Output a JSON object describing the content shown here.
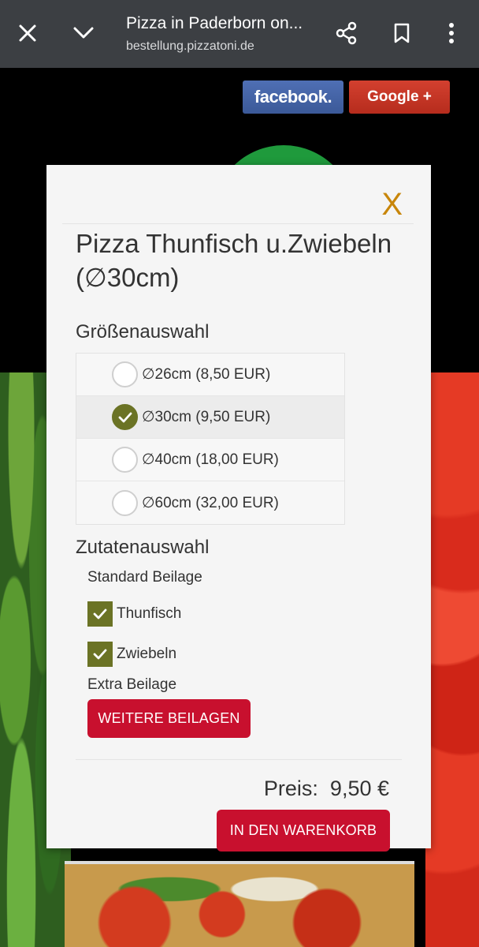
{
  "browser": {
    "title": "Pizza in Paderborn on...",
    "url": "bestellung.pizzatoni.de"
  },
  "social": {
    "facebook": "facebook.",
    "google": "Google +"
  },
  "modal": {
    "close": "X",
    "title": "Pizza Thunfisch u.Zwiebeln (∅30cm)",
    "size_heading": "Größenauswahl",
    "sizes": [
      {
        "label": "∅26cm (8,50 EUR)",
        "selected": false
      },
      {
        "label": "∅30cm (9,50 EUR)",
        "selected": true
      },
      {
        "label": "∅40cm (18,00 EUR)",
        "selected": false
      },
      {
        "label": "∅60cm (32,00 EUR)",
        "selected": false
      }
    ],
    "toppings_heading": "Zutatenauswahl",
    "standard_label": "Standard Beilage",
    "standard_items": [
      {
        "label": "Thunfisch",
        "checked": true
      },
      {
        "label": "Zwiebeln",
        "checked": true
      }
    ],
    "extra_label": "Extra Beilage",
    "more_button": "WEITERE BEILAGEN",
    "price_label": "Preis:",
    "price_value": "9,50 €",
    "cart_button": "IN DEN WARENKORB"
  },
  "colors": {
    "accent_green": "#6b7325",
    "button_red": "#c8102e",
    "close_orange": "#c8860a"
  }
}
